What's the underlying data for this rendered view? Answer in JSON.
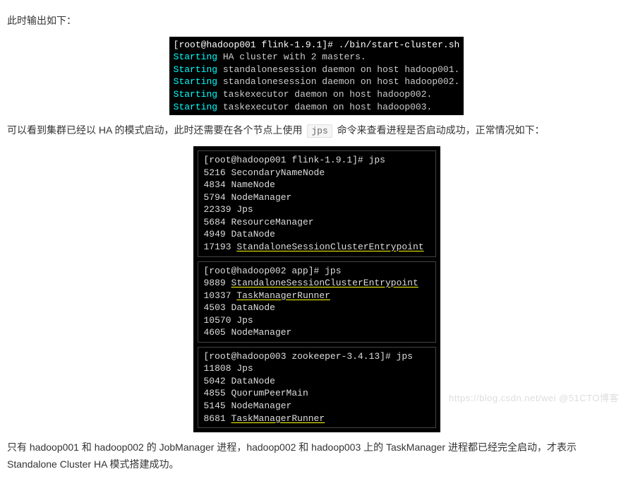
{
  "intro": "此时输出如下：",
  "term1": {
    "prompt": "[root@hadoop001 flink-1.9.1]# ./bin/start-cluster.sh",
    "lines": [
      {
        "keyword": "Starting",
        "rest": "HA cluster with 2 masters."
      },
      {
        "keyword": "Starting",
        "rest": "standalonesession daemon on host hadoop001."
      },
      {
        "keyword": "Starting",
        "rest": "standalonesession daemon on host hadoop002."
      },
      {
        "keyword": "Starting",
        "rest": "taskexecutor daemon on host hadoop002."
      },
      {
        "keyword": "Starting",
        "rest": "taskexecutor daemon on host hadoop003."
      }
    ]
  },
  "mid_text_a": "可以看到集群已经以 HA 的模式启动，此时还需要在各个节点上使用 ",
  "mid_code": "jps",
  "mid_text_b": " 命令来查看进程是否启动成功，正常情况如下：",
  "panel1": {
    "prompt": "[root@hadoop001 flink-1.9.1]# jps",
    "lines": [
      {
        "pid": "5216",
        "name": "SecondaryNameNode",
        "ul": false
      },
      {
        "pid": "4834",
        "name": "NameNode",
        "ul": false
      },
      {
        "pid": "5794",
        "name": "NodeManager",
        "ul": false
      },
      {
        "pid": "22339",
        "name": "Jps",
        "ul": false
      },
      {
        "pid": "5684",
        "name": "ResourceManager",
        "ul": false
      },
      {
        "pid": "4949",
        "name": "DataNode",
        "ul": false
      },
      {
        "pid": "17193",
        "name": "StandaloneSessionClusterEntrypoint",
        "ul": true
      }
    ]
  },
  "panel2": {
    "prompt": "[root@hadoop002 app]# jps",
    "lines": [
      {
        "pid": "9889",
        "name": "StandaloneSessionClusterEntrypoint",
        "ul": true
      },
      {
        "pid": "10337",
        "name": "TaskManagerRunner",
        "ul": true
      },
      {
        "pid": "4503",
        "name": "DataNode",
        "ul": false
      },
      {
        "pid": "10570",
        "name": "Jps",
        "ul": false
      },
      {
        "pid": "4605",
        "name": "NodeManager",
        "ul": false
      }
    ]
  },
  "panel3": {
    "prompt": "[root@hadoop003 zookeeper-3.4.13]# jps",
    "lines": [
      {
        "pid": "11808",
        "name": "Jps",
        "ul": false
      },
      {
        "pid": "5042",
        "name": "DataNode",
        "ul": false
      },
      {
        "pid": "4855",
        "name": "QuorumPeerMain",
        "ul": false
      },
      {
        "pid": "5145",
        "name": "NodeManager",
        "ul": false
      },
      {
        "pid": "8681",
        "name": "TaskManagerRunner",
        "ul": true
      }
    ]
  },
  "outro": "只有 hadoop001 和 hadoop002 的 JobManager 进程，hadoop002 和 hadoop003 上的 TaskManager 进程都已经完全启动，才表示 Standalone Cluster HA 模式搭建成功。",
  "watermark": "https://blog.csdn.net/wei  @51CTO博客"
}
